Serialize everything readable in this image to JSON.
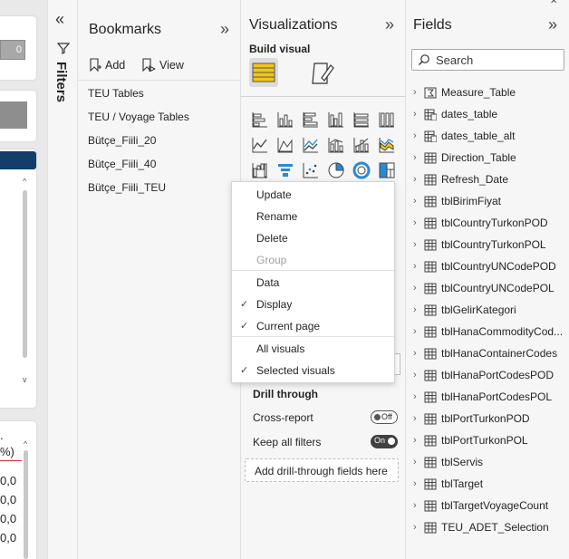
{
  "canvas": {
    "card1_value": "0",
    "card4_lines": [
      ".",
      "%)",
      "0,0",
      "0,0",
      "0,0",
      "0,0"
    ]
  },
  "filters": {
    "label": "Filters"
  },
  "bookmarks": {
    "title": "Bookmarks",
    "add_label": "Add",
    "view_label": "View",
    "items": [
      {
        "label": "TEU Tables"
      },
      {
        "label": "TEU / Voyage Tables"
      },
      {
        "label": "Bütçe_Fiili_20"
      },
      {
        "label": "Bütçe_Fiili_40"
      },
      {
        "label": "Bütçe_Fiili_TEU"
      }
    ]
  },
  "visualizations": {
    "title": "Visualizations",
    "build_visual_label": "Build visual",
    "drill_through_label": "Drill through",
    "cross_report_label": "Cross-report",
    "cross_report_toggle": "Off",
    "keep_filters_label": "Keep all filters",
    "keep_filters_toggle": "On",
    "add_drill_placeholder": "Add drill-through fields here"
  },
  "context_menu": {
    "items": [
      {
        "label": "Update",
        "enabled": true
      },
      {
        "label": "Rename",
        "enabled": true
      },
      {
        "label": "Delete",
        "enabled": true
      },
      {
        "label": "Group",
        "enabled": false
      },
      {
        "label": "Data",
        "checked": false
      },
      {
        "label": "Display",
        "checked": true
      },
      {
        "label": "Current page",
        "checked": true
      },
      {
        "label": "All visuals",
        "checked": false
      },
      {
        "label": "Selected visuals",
        "checked": true
      }
    ]
  },
  "fields": {
    "title": "Fields",
    "search_placeholder": "Search",
    "tables": [
      {
        "name": "Measure_Table",
        "icon": "measure-table-icon"
      },
      {
        "name": "dates_table",
        "icon": "calendar-table-icon"
      },
      {
        "name": "dates_table_alt",
        "icon": "calendar-table-icon"
      },
      {
        "name": "Direction_Table",
        "icon": "table-icon"
      },
      {
        "name": "Refresh_Date",
        "icon": "table-icon"
      },
      {
        "name": "tblBirimFiyat",
        "icon": "table-icon"
      },
      {
        "name": "tblCountryTurkonPOD",
        "icon": "table-icon"
      },
      {
        "name": "tblCountryTurkonPOL",
        "icon": "table-icon"
      },
      {
        "name": "tblCountryUNCodePOD",
        "icon": "table-icon"
      },
      {
        "name": "tblCountryUNCodePOL",
        "icon": "table-icon"
      },
      {
        "name": "tblGelirKategori",
        "icon": "table-icon"
      },
      {
        "name": "tblHanaCommodityCod...",
        "icon": "table-icon"
      },
      {
        "name": "tblHanaContainerCodes",
        "icon": "table-icon"
      },
      {
        "name": "tblHanaPortCodesPOD",
        "icon": "table-icon"
      },
      {
        "name": "tblHanaPortCodesPOL",
        "icon": "table-icon"
      },
      {
        "name": "tblPortTurkonPOD",
        "icon": "table-icon"
      },
      {
        "name": "tblPortTurkonPOL",
        "icon": "table-icon"
      },
      {
        "name": "tblServis",
        "icon": "table-icon"
      },
      {
        "name": "tblTarget",
        "icon": "table-icon"
      },
      {
        "name": "tblTargetVoyageCount",
        "icon": "table-icon"
      },
      {
        "name": "TEU_ADET_Selection",
        "icon": "table-icon"
      }
    ]
  },
  "colors": {
    "canvas_header": "#133d6b",
    "build_visual_accent": "#f2c811",
    "toggle_on": "#404040"
  }
}
